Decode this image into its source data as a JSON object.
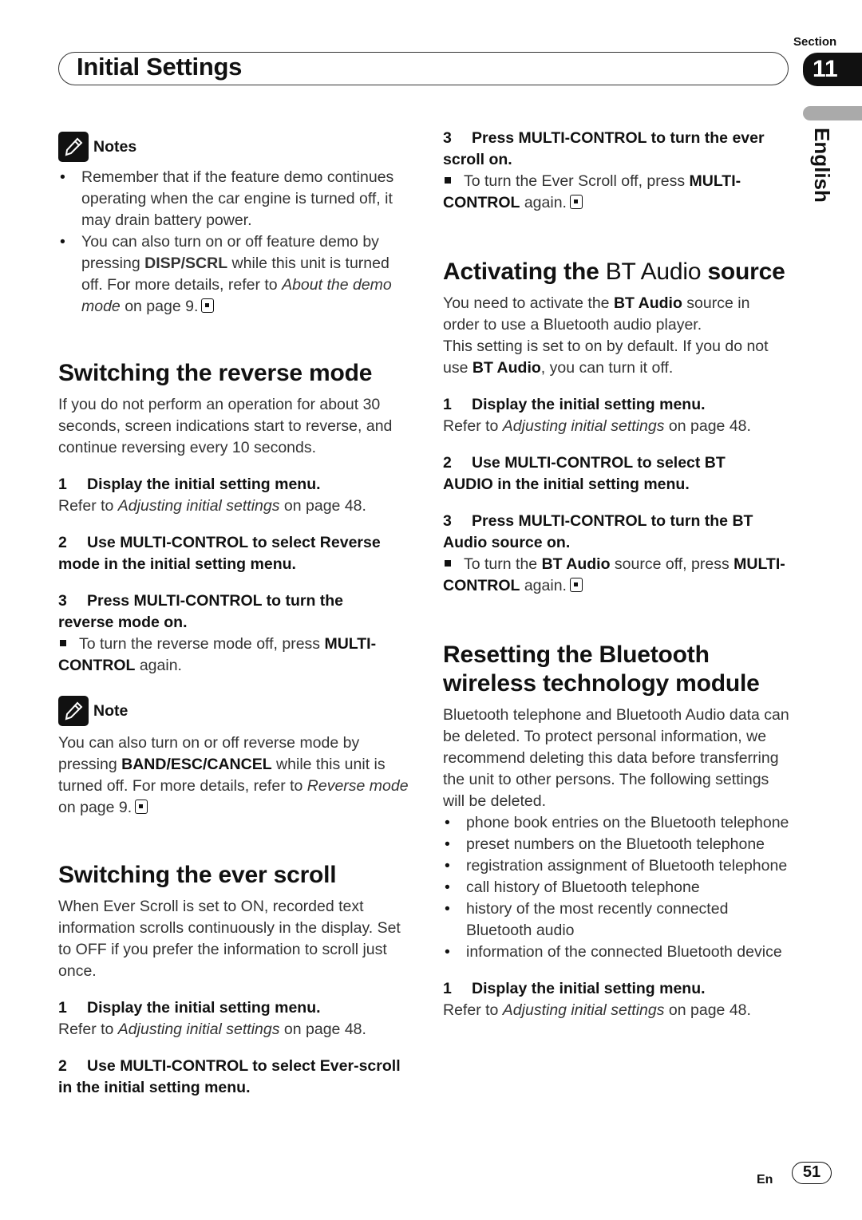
{
  "header": {
    "title": "Initial Settings",
    "section_label": "Section",
    "section_number": "11",
    "language_tab": "English"
  },
  "left": {
    "notes": {
      "heading": "Notes",
      "items": [
        {
          "text": "Remember that if the feature demo continues operating when the car engine is turned off, it may drain battery power."
        },
        {
          "pre": "You can also turn on or off feature demo by pressing ",
          "bold": "DISP/SCRL",
          "mid": " while this unit is turned off. For more details, refer to ",
          "italic": "About the demo mode",
          "post": " on page 9."
        }
      ]
    },
    "reverse": {
      "heading": "Switching the reverse mode",
      "intro": "If you do not perform an operation for about 30 seconds, screen indications start to reverse, and continue reversing every 10 seconds.",
      "step1": {
        "num": "1",
        "text": "Display the initial setting menu.",
        "ref_pre": "Refer to ",
        "ref_italic": "Adjusting initial settings",
        "ref_post": " on page 48."
      },
      "step2": {
        "num": "2",
        "text": "Use MULTI-CONTROL to select Reverse mode in the initial setting menu."
      },
      "step3": {
        "num": "3",
        "text": "Press MULTI-CONTROL to turn the reverse mode on.",
        "sub_pre": "To turn the reverse mode off, press ",
        "sub_bold": "MULTI-CONTROL",
        "sub_post": " again."
      },
      "note": {
        "heading": "Note",
        "pre": "You can also turn on or off reverse mode by pressing ",
        "bold": "BAND/ESC/CANCEL",
        "mid": " while this unit is turned off. For more details, refer to ",
        "italic": "Reverse mode",
        "post": " on page 9."
      }
    },
    "everscroll": {
      "heading": "Switching the ever scroll",
      "intro": "When Ever Scroll is set to ON, recorded text information scrolls continuously in the display. Set to OFF if you prefer the information to scroll just once.",
      "step1": {
        "num": "1",
        "text": "Display the initial setting menu.",
        "ref_pre": "Refer to ",
        "ref_italic": "Adjusting initial settings",
        "ref_post": " on page 48."
      },
      "step2": {
        "num": "2",
        "text": "Use MULTI-CONTROL to select Ever-scroll in the initial setting menu."
      }
    }
  },
  "right": {
    "everscroll_step3": {
      "num": "3",
      "text": "Press MULTI-CONTROL to turn the ever scroll on.",
      "sub_pre": "To turn the Ever Scroll off, press ",
      "sub_bold": "MULTI-CONTROL",
      "sub_post": " again."
    },
    "btaudio": {
      "heading_pre": "Activating the ",
      "heading_mid": "BT Audio",
      "heading_post": " source",
      "intro1_pre": "You need to activate the ",
      "intro1_bold": "BT Audio",
      "intro1_post": " source in order to use a Bluetooth audio player.",
      "intro2_pre": "This setting is set to on by default. If you do not use ",
      "intro2_bold": "BT Audio",
      "intro2_post": ", you can turn it off.",
      "step1": {
        "num": "1",
        "text": "Display the initial setting menu.",
        "ref_pre": "Refer to ",
        "ref_italic": "Adjusting initial settings",
        "ref_post": " on page 48."
      },
      "step2": {
        "num": "2",
        "text": "Use MULTI-CONTROL to select BT AUDIO in the initial setting menu."
      },
      "step3": {
        "num": "3",
        "text": "Press MULTI-CONTROL to turn the BT Audio source on.",
        "sub_pre": "To turn the ",
        "sub_bold1": "BT Audio",
        "sub_mid": " source off, press ",
        "sub_bold2": "MULTI-CONTROL",
        "sub_post": " again."
      }
    },
    "reset": {
      "heading": "Resetting the Bluetooth wireless technology module",
      "intro": "Bluetooth telephone and Bluetooth Audio data can be deleted. To protect personal information, we recommend deleting this data before transferring the unit to other persons. The following settings will be deleted.",
      "items": [
        "phone book entries on the Bluetooth telephone",
        "preset numbers on the Bluetooth telephone",
        "registration assignment of Bluetooth telephone",
        "call history of Bluetooth telephone",
        "history of the most recently connected Bluetooth audio",
        "information of the connected Bluetooth device"
      ],
      "step1": {
        "num": "1",
        "text": "Display the initial setting menu.",
        "ref_pre": "Refer to ",
        "ref_italic": "Adjusting initial settings",
        "ref_post": " on page 48."
      }
    }
  },
  "footer": {
    "lang_code": "En",
    "page_number": "51"
  }
}
